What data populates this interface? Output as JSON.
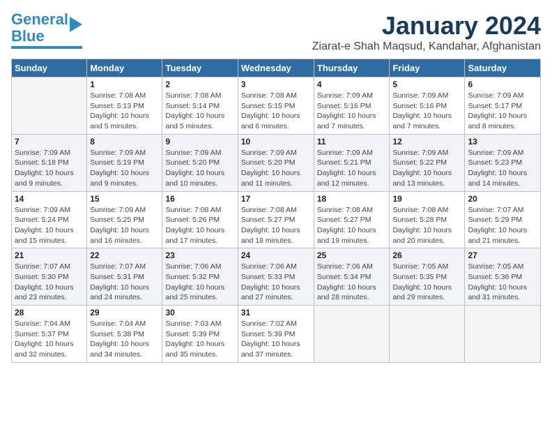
{
  "logo": {
    "line1": "General",
    "line2": "Blue"
  },
  "title": "January 2024",
  "subtitle": "Ziarat-e Shah Maqsud, Kandahar, Afghanistan",
  "headers": [
    "Sunday",
    "Monday",
    "Tuesday",
    "Wednesday",
    "Thursday",
    "Friday",
    "Saturday"
  ],
  "weeks": [
    [
      {
        "day": "",
        "info": ""
      },
      {
        "day": "1",
        "info": "Sunrise: 7:08 AM\nSunset: 5:13 PM\nDaylight: 10 hours\nand 5 minutes."
      },
      {
        "day": "2",
        "info": "Sunrise: 7:08 AM\nSunset: 5:14 PM\nDaylight: 10 hours\nand 5 minutes."
      },
      {
        "day": "3",
        "info": "Sunrise: 7:08 AM\nSunset: 5:15 PM\nDaylight: 10 hours\nand 6 minutes."
      },
      {
        "day": "4",
        "info": "Sunrise: 7:09 AM\nSunset: 5:16 PM\nDaylight: 10 hours\nand 7 minutes."
      },
      {
        "day": "5",
        "info": "Sunrise: 7:09 AM\nSunset: 5:16 PM\nDaylight: 10 hours\nand 7 minutes."
      },
      {
        "day": "6",
        "info": "Sunrise: 7:09 AM\nSunset: 5:17 PM\nDaylight: 10 hours\nand 8 minutes."
      }
    ],
    [
      {
        "day": "7",
        "info": "Sunrise: 7:09 AM\nSunset: 5:18 PM\nDaylight: 10 hours\nand 9 minutes."
      },
      {
        "day": "8",
        "info": "Sunrise: 7:09 AM\nSunset: 5:19 PM\nDaylight: 10 hours\nand 9 minutes."
      },
      {
        "day": "9",
        "info": "Sunrise: 7:09 AM\nSunset: 5:20 PM\nDaylight: 10 hours\nand 10 minutes."
      },
      {
        "day": "10",
        "info": "Sunrise: 7:09 AM\nSunset: 5:20 PM\nDaylight: 10 hours\nand 11 minutes."
      },
      {
        "day": "11",
        "info": "Sunrise: 7:09 AM\nSunset: 5:21 PM\nDaylight: 10 hours\nand 12 minutes."
      },
      {
        "day": "12",
        "info": "Sunrise: 7:09 AM\nSunset: 5:22 PM\nDaylight: 10 hours\nand 13 minutes."
      },
      {
        "day": "13",
        "info": "Sunrise: 7:09 AM\nSunset: 5:23 PM\nDaylight: 10 hours\nand 14 minutes."
      }
    ],
    [
      {
        "day": "14",
        "info": "Sunrise: 7:09 AM\nSunset: 5:24 PM\nDaylight: 10 hours\nand 15 minutes."
      },
      {
        "day": "15",
        "info": "Sunrise: 7:09 AM\nSunset: 5:25 PM\nDaylight: 10 hours\nand 16 minutes."
      },
      {
        "day": "16",
        "info": "Sunrise: 7:08 AM\nSunset: 5:26 PM\nDaylight: 10 hours\nand 17 minutes."
      },
      {
        "day": "17",
        "info": "Sunrise: 7:08 AM\nSunset: 5:27 PM\nDaylight: 10 hours\nand 18 minutes."
      },
      {
        "day": "18",
        "info": "Sunrise: 7:08 AM\nSunset: 5:27 PM\nDaylight: 10 hours\nand 19 minutes."
      },
      {
        "day": "19",
        "info": "Sunrise: 7:08 AM\nSunset: 5:28 PM\nDaylight: 10 hours\nand 20 minutes."
      },
      {
        "day": "20",
        "info": "Sunrise: 7:07 AM\nSunset: 5:29 PM\nDaylight: 10 hours\nand 21 minutes."
      }
    ],
    [
      {
        "day": "21",
        "info": "Sunrise: 7:07 AM\nSunset: 5:30 PM\nDaylight: 10 hours\nand 23 minutes."
      },
      {
        "day": "22",
        "info": "Sunrise: 7:07 AM\nSunset: 5:31 PM\nDaylight: 10 hours\nand 24 minutes."
      },
      {
        "day": "23",
        "info": "Sunrise: 7:06 AM\nSunset: 5:32 PM\nDaylight: 10 hours\nand 25 minutes."
      },
      {
        "day": "24",
        "info": "Sunrise: 7:06 AM\nSunset: 5:33 PM\nDaylight: 10 hours\nand 27 minutes."
      },
      {
        "day": "25",
        "info": "Sunrise: 7:06 AM\nSunset: 5:34 PM\nDaylight: 10 hours\nand 28 minutes."
      },
      {
        "day": "26",
        "info": "Sunrise: 7:05 AM\nSunset: 5:35 PM\nDaylight: 10 hours\nand 29 minutes."
      },
      {
        "day": "27",
        "info": "Sunrise: 7:05 AM\nSunset: 5:36 PM\nDaylight: 10 hours\nand 31 minutes."
      }
    ],
    [
      {
        "day": "28",
        "info": "Sunrise: 7:04 AM\nSunset: 5:37 PM\nDaylight: 10 hours\nand 32 minutes."
      },
      {
        "day": "29",
        "info": "Sunrise: 7:04 AM\nSunset: 5:38 PM\nDaylight: 10 hours\nand 34 minutes."
      },
      {
        "day": "30",
        "info": "Sunrise: 7:03 AM\nSunset: 5:39 PM\nDaylight: 10 hours\nand 35 minutes."
      },
      {
        "day": "31",
        "info": "Sunrise: 7:02 AM\nSunset: 5:39 PM\nDaylight: 10 hours\nand 37 minutes."
      },
      {
        "day": "",
        "info": ""
      },
      {
        "day": "",
        "info": ""
      },
      {
        "day": "",
        "info": ""
      }
    ]
  ]
}
